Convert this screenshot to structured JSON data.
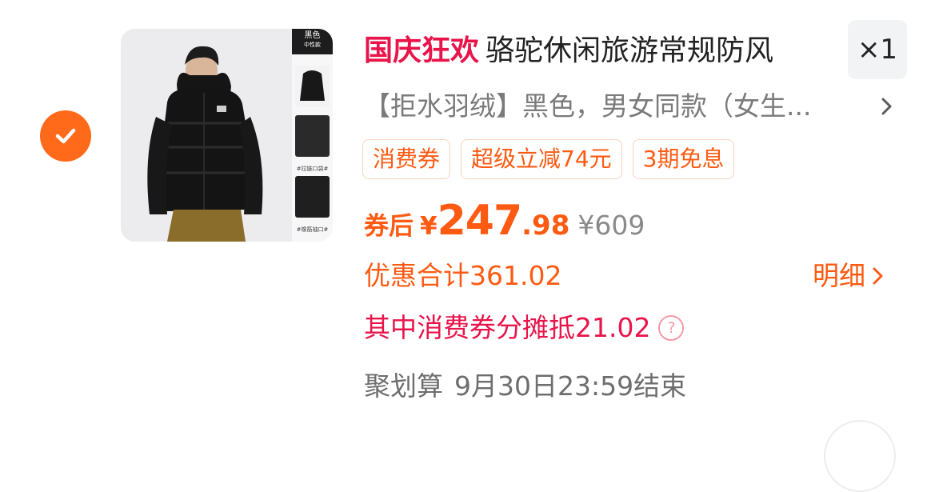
{
  "item": {
    "checked": true,
    "image": {
      "swatch_label": "黑色",
      "swatch_sub": "中性款",
      "caption_zipper": "#拉链口袋#",
      "caption_cuff": "#橡筋袖口#"
    },
    "title_highlight": "国庆狂欢",
    "title": "骆驼休闲旅游常规防风",
    "quantity": "×1",
    "sku": "【拒水羽绒】黑色，男女同款（女生...",
    "tags": [
      "消费券",
      "超级立减74元",
      "3期免息"
    ],
    "price": {
      "label": "券后",
      "currency": "¥",
      "integer": "247",
      "decimal": ".98",
      "original": "¥609"
    },
    "discount_total": "优惠合计361.02",
    "detail_label": "明细",
    "coupon_share": "其中消费券分摊抵21.02",
    "event_name": "聚划算",
    "event_end": "9月30日23:59结束"
  },
  "colors": {
    "accent_orange": "#ff6a1a",
    "promo_red": "#e8144a"
  },
  "icons": [
    "check-icon",
    "chevron-right-icon",
    "question-circle-icon"
  ]
}
